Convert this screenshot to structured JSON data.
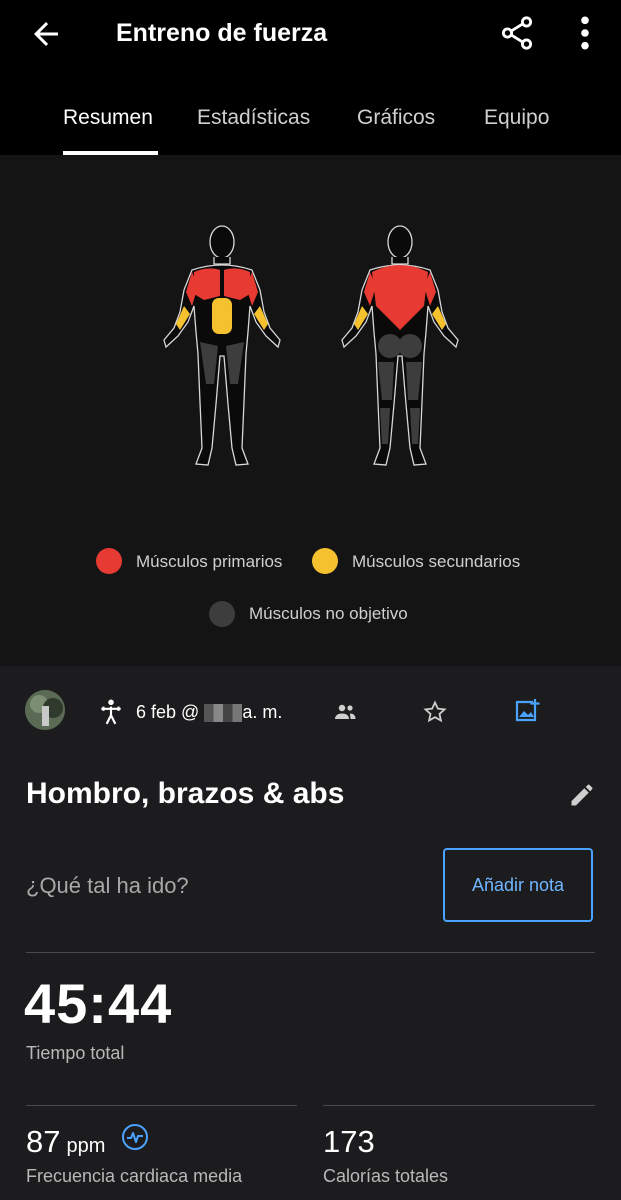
{
  "header": {
    "title": "Entreno de fuerza",
    "tabs": [
      {
        "label": "Resumen",
        "active": true
      },
      {
        "label": "Estadísticas",
        "active": false
      },
      {
        "label": "Gráficos",
        "active": false
      },
      {
        "label": "Equipo",
        "active": false
      }
    ]
  },
  "muscles": {
    "legend": [
      {
        "label": "Músculos primarios",
        "color": "#e63a33"
      },
      {
        "label": "Músculos secundarios",
        "color": "#f5c12e"
      },
      {
        "label": "Músculos no objetivo",
        "color": "#3d3d3d"
      }
    ]
  },
  "activity": {
    "date": "6 feb @ ",
    "time_suffix": "a. m.",
    "name": "Hombro, brazos & abs",
    "note_prompt": "¿Qué tal ha ido?",
    "add_note_label": "Añadir nota"
  },
  "stats": {
    "total_time": "45:44",
    "total_time_label": "Tiempo total",
    "hr_value": "87",
    "hr_unit": "ppm",
    "hr_label": "Frecuencia cardiaca media",
    "calories_value": "173",
    "calories_label": "Calorías totales"
  },
  "icons": {
    "back": "arrow-left-icon",
    "share": "share-icon",
    "more": "more-vertical-icon",
    "activity_type": "strength-training-icon",
    "people": "people-icon",
    "favorite": "star-outline-icon",
    "add_photo": "add-photo-icon",
    "edit": "pencil-icon",
    "hr_zone": "heart-rate-icon"
  },
  "colors": {
    "accent": "#4aa3ff",
    "primary_muscle": "#e63a33",
    "secondary_muscle": "#f5c12e",
    "non_target_muscle": "#3d3d3d"
  }
}
